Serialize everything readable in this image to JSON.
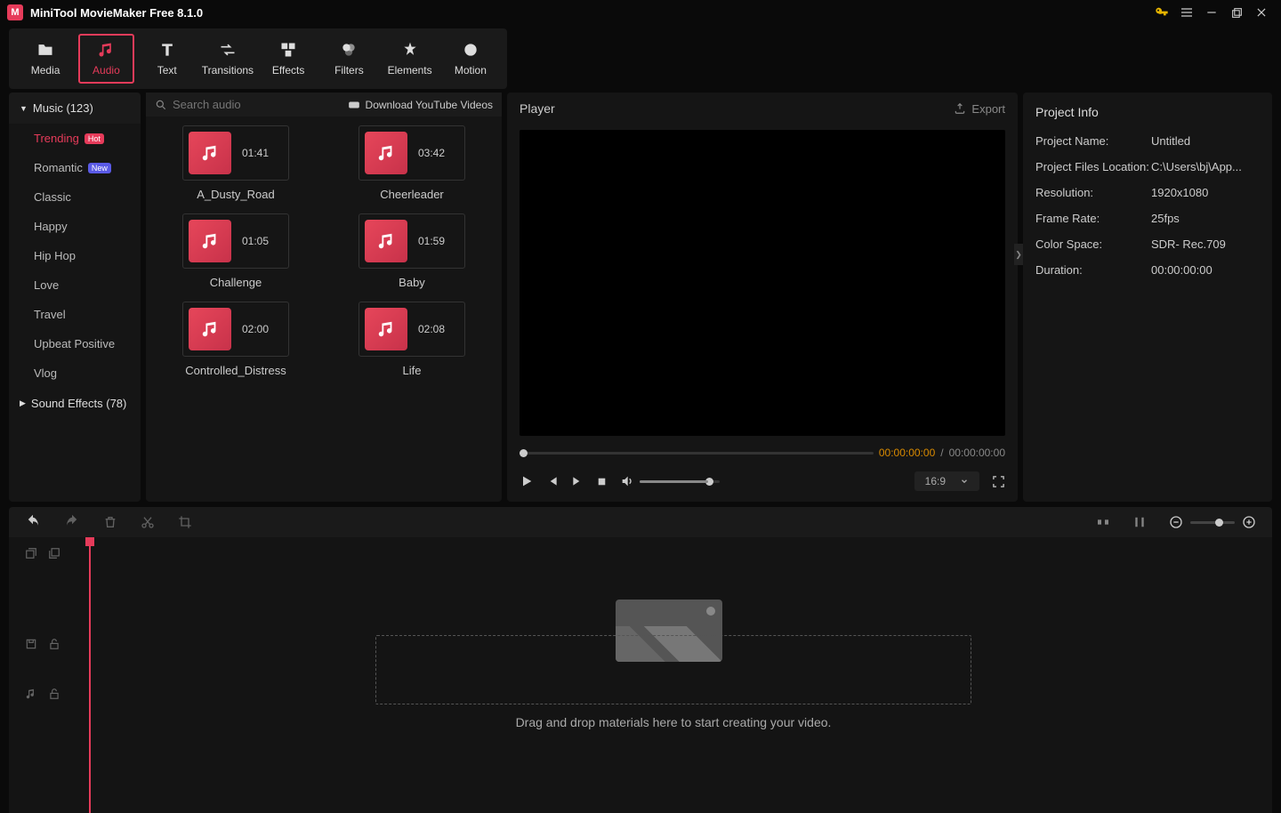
{
  "titlebar": {
    "title": "MiniTool MovieMaker Free 8.1.0"
  },
  "tabs": [
    {
      "label": "Media"
    },
    {
      "label": "Audio"
    },
    {
      "label": "Text"
    },
    {
      "label": "Transitions"
    },
    {
      "label": "Effects"
    },
    {
      "label": "Filters"
    },
    {
      "label": "Elements"
    },
    {
      "label": "Motion"
    }
  ],
  "sidebar": {
    "music_label": "Music (123)",
    "items": [
      {
        "label": "Trending",
        "badge": "Hot",
        "badgeClass": "hot"
      },
      {
        "label": "Romantic",
        "badge": "New",
        "badgeClass": "new"
      },
      {
        "label": "Classic"
      },
      {
        "label": "Happy"
      },
      {
        "label": "Hip Hop"
      },
      {
        "label": "Love"
      },
      {
        "label": "Travel"
      },
      {
        "label": "Upbeat Positive"
      },
      {
        "label": "Vlog"
      }
    ],
    "sfx_label": "Sound Effects (78)"
  },
  "search": {
    "placeholder": "Search audio"
  },
  "download_btn": "Download YouTube Videos",
  "audio_items": [
    {
      "name": "A_Dusty_Road",
      "dur": "01:41"
    },
    {
      "name": "Cheerleader",
      "dur": "03:42"
    },
    {
      "name": "Challenge",
      "dur": "01:05"
    },
    {
      "name": "Baby",
      "dur": "01:59"
    },
    {
      "name": "Controlled_Distress",
      "dur": "02:00"
    },
    {
      "name": "Life",
      "dur": "02:08"
    }
  ],
  "player": {
    "title": "Player",
    "export": "Export",
    "cur": "00:00:00:00",
    "sep": " / ",
    "tot": "00:00:00:00",
    "aspect": "16:9"
  },
  "info": {
    "title": "Project Info",
    "rows": [
      {
        "k": "Project Name:",
        "v": "Untitled"
      },
      {
        "k": "Project Files Location:",
        "v": "C:\\Users\\bj\\App..."
      },
      {
        "k": "Resolution:",
        "v": "1920x1080"
      },
      {
        "k": "Frame Rate:",
        "v": "25fps"
      },
      {
        "k": "Color Space:",
        "v": "SDR- Rec.709"
      },
      {
        "k": "Duration:",
        "v": "00:00:00:00"
      }
    ]
  },
  "timeline": {
    "drop_text": "Drag and drop materials here to start creating your video."
  }
}
